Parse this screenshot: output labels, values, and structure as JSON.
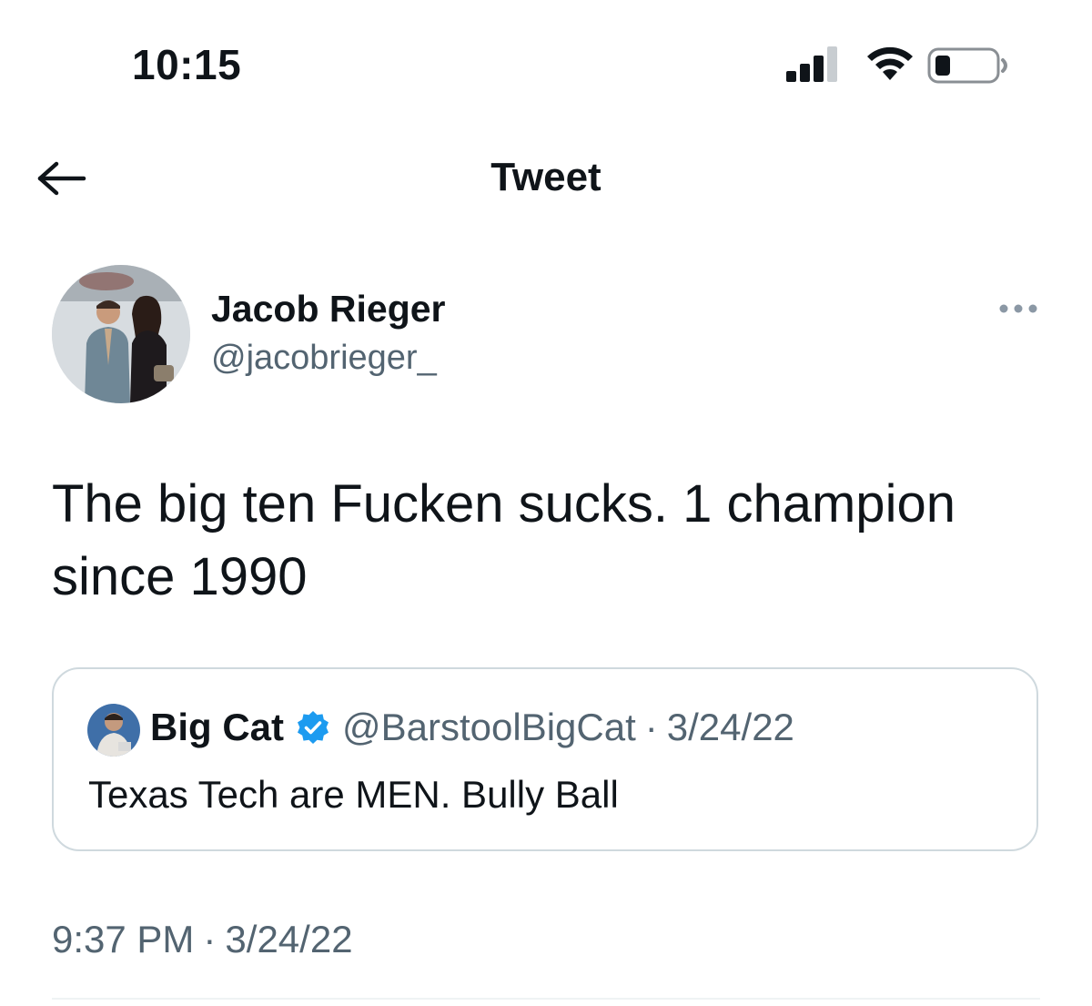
{
  "status_bar": {
    "time": "10:15",
    "icons": [
      "signal-icon",
      "wifi-icon",
      "battery-icon"
    ]
  },
  "nav": {
    "title": "Tweet",
    "back_icon": "arrow-left-icon"
  },
  "tweet": {
    "author_name": "Jacob Rieger",
    "author_handle": "@jacobrieger_",
    "more_icon": "more-horizontal-icon",
    "text": "The big ten Fucken sucks. 1 champion since 1990",
    "time": "9:37 PM",
    "separator": "·",
    "date": "3/24/22"
  },
  "quoted_tweet": {
    "author_name": "Big Cat",
    "verified": true,
    "author_handle": "@BarstoolBigCat",
    "separator": "·",
    "date": "3/24/22",
    "text": "Texas Tech are MEN. Bully Ball"
  },
  "colors": {
    "text_primary": "#0f1419",
    "text_secondary": "#536471",
    "border": "#cfd9de",
    "verified_blue": "#1d9bf0"
  }
}
